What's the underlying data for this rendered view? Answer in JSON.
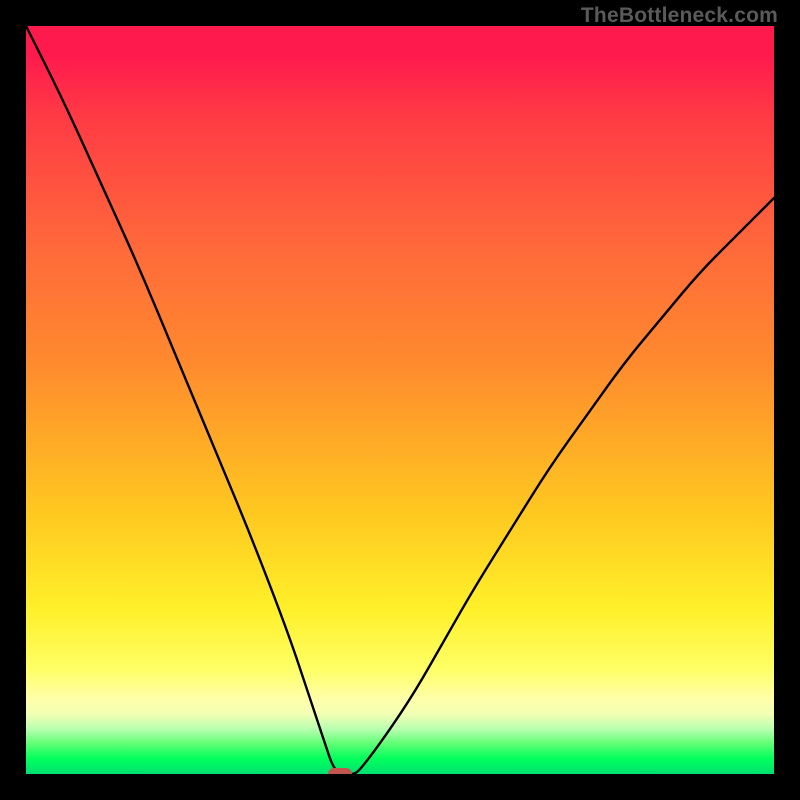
{
  "watermark": "TheBottleneck.com",
  "colors": {
    "curve": "#000000",
    "marker": "#c1564e",
    "background_black": "#000000"
  },
  "chart_data": {
    "type": "line",
    "title": "",
    "xlabel": "",
    "ylabel": "",
    "xlim": [
      0,
      100
    ],
    "ylim": [
      0,
      100
    ],
    "grid": false,
    "min_point": {
      "x": 42,
      "y": 0
    },
    "series": [
      {
        "name": "bottleneck-curve",
        "x": [
          0,
          5,
          10,
          15,
          20,
          25,
          30,
          35,
          38,
          40,
          41,
          42,
          43,
          44,
          45,
          48,
          52,
          56,
          60,
          65,
          70,
          75,
          80,
          85,
          90,
          95,
          100
        ],
        "y": [
          100,
          90,
          79,
          68,
          56,
          44,
          32,
          19,
          10,
          4,
          1,
          0,
          0,
          0,
          1,
          5,
          11,
          18,
          25,
          33,
          41,
          48,
          55,
          61,
          67,
          72,
          77
        ]
      }
    ],
    "marker": {
      "x": 42,
      "y": 0
    }
  }
}
